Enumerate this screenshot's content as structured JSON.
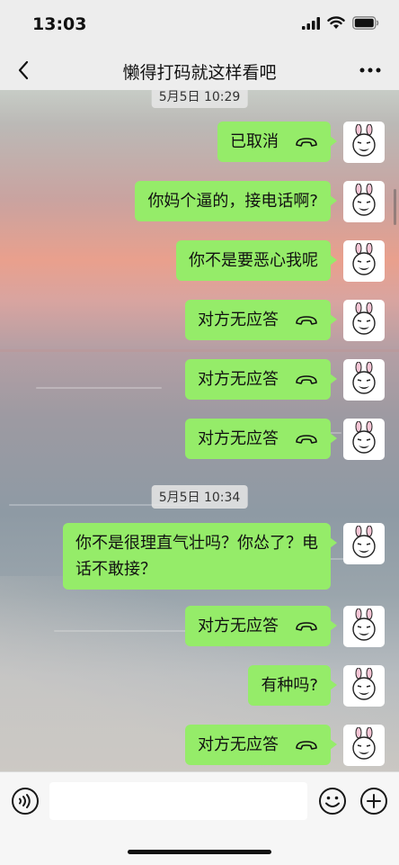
{
  "status_bar": {
    "time": "13:03"
  },
  "nav": {
    "title": "懒得打码就这样看吧"
  },
  "chat": {
    "timestamps": [
      {
        "text": "5月5日 10:29"
      },
      {
        "text": "5月5日 10:34"
      }
    ],
    "messages": [
      {
        "text": "已取消",
        "type": "call",
        "icon": "hangup-icon"
      },
      {
        "text": "你妈个逼的，接电话啊?",
        "type": "text"
      },
      {
        "text": "你不是要恶心我呢",
        "type": "text"
      },
      {
        "text": "对方无应答",
        "type": "call",
        "icon": "hangup-icon"
      },
      {
        "text": "对方无应答",
        "type": "call",
        "icon": "hangup-icon"
      },
      {
        "text": "对方无应答",
        "type": "call",
        "icon": "hangup-icon"
      },
      {
        "text": "你不是很理直气壮吗？你怂了？电话不敢接？",
        "type": "text"
      },
      {
        "text": "对方无应答",
        "type": "call",
        "icon": "hangup-icon"
      },
      {
        "text": "有种吗?",
        "type": "text"
      },
      {
        "text": "对方无应答",
        "type": "call",
        "icon": "hangup-icon"
      }
    ],
    "bubble_color": "#95ec69"
  },
  "input_bar": {
    "text_value": "",
    "icons": [
      "voice-icon",
      "emoji-icon",
      "plus-icon"
    ]
  }
}
